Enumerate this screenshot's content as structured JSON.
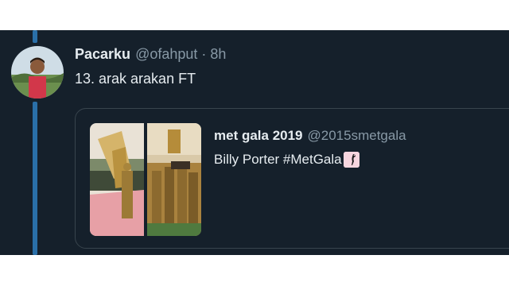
{
  "tweet": {
    "author_name": "Pacarku",
    "author_handle": "@ofahput",
    "separator": "·",
    "time": "8h",
    "text": "13. arak arakan FT"
  },
  "quoted_tweet": {
    "author_name": "met gala 2019",
    "author_handle": "@2015smetgala",
    "text": "Billy Porter #MetGala",
    "emoji_icon": "flamingo-icon"
  },
  "colors": {
    "background": "#15202b",
    "primary_text": "#e6ecf0",
    "secondary_text": "#8899a6",
    "thread_line": "#2a6fa8",
    "card_border": "#38444d"
  }
}
